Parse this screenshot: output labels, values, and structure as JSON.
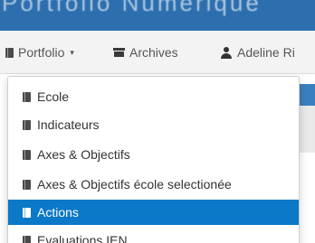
{
  "banner": {
    "title": "Portfolio Numérique"
  },
  "navbar": {
    "portfolio_label": "Portfolio",
    "portfolio_caret": "▾",
    "archives_label": "Archives",
    "user_label": "Adeline Ri"
  },
  "dropdown": {
    "items": [
      {
        "label": "Ecole",
        "icon": "book-icon",
        "active": false
      },
      {
        "label": "Indicateurs",
        "icon": "book-icon",
        "active": false
      },
      {
        "label": "Axes & Objectifs",
        "icon": "book-icon",
        "active": false
      },
      {
        "label": "Axes & Objectifs école selectionée",
        "icon": "book-icon",
        "active": false
      },
      {
        "label": "Actions",
        "icon": "book-icon",
        "active": true
      },
      {
        "label": "Evaluations IEN",
        "icon": "book-icon",
        "active": false
      }
    ]
  },
  "colors": {
    "banner": "#2d6fae",
    "navbar": "#f3f3f3",
    "active_item": "#0b78c8"
  }
}
